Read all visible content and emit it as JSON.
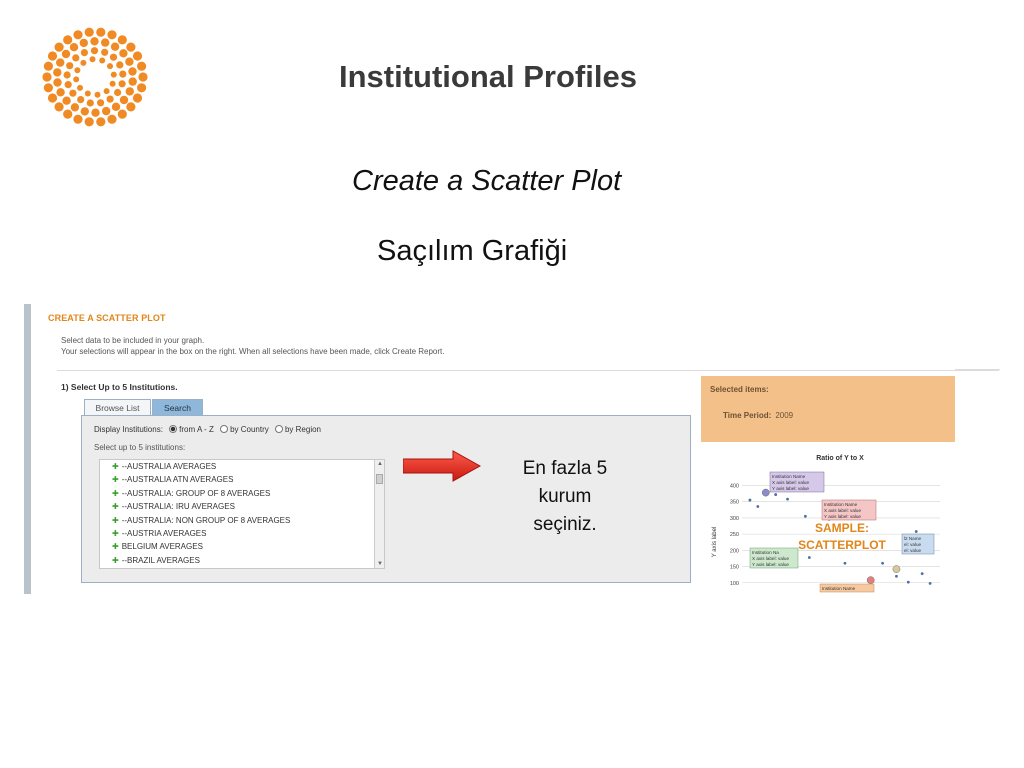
{
  "slide": {
    "title": "Institutional Profiles",
    "subtitle_en": "Create a Scatter Plot",
    "subtitle_tr": "Saçılım Grafiği",
    "callout_lines": [
      "En fazla 5",
      "kurum",
      "seçiniz."
    ]
  },
  "colors": {
    "accent": "#e0861a",
    "logo": "#f08a24",
    "arrow": "#e0261d",
    "selected_panel": "#f3c08a"
  },
  "screenshot": {
    "heading": "CREATE A SCATTER PLOT",
    "intro_line1": "Select data to be included in your graph.",
    "intro_line2": "Your selections will appear in the box on the right. When all selections have been made, click Create Report.",
    "step_label": "1) Select Up to 5 Institutions.",
    "tabs": [
      {
        "label": "Browse List",
        "active": false
      },
      {
        "label": "Search",
        "active": true
      }
    ],
    "display_label": "Display Institutions:",
    "display_options": [
      {
        "label": "from A - Z",
        "selected": true
      },
      {
        "label": "by Country",
        "selected": false
      },
      {
        "label": "by Region",
        "selected": false
      }
    ],
    "select_hint": "Select up to 5 institutions:",
    "institutions": [
      "--AUSTRALIA AVERAGES",
      "--AUSTRALIA ATN AVERAGES",
      "--AUSTRALIA: GROUP OF 8 AVERAGES",
      "--AUSTRALIA: IRU AVERAGES",
      "--AUSTRALIA: NON GROUP OF 8 AVERAGES",
      "--AUSTRIA AVERAGES",
      "BELGIUM AVERAGES",
      "--BRAZIL AVERAGES"
    ],
    "selected_items_title": "Selected items:",
    "time_period_label": "Time Period:",
    "time_period_value": "2009"
  },
  "chart_data": {
    "type": "scatter",
    "title": "Ratio of Y to X",
    "ylabel": "Y axis label",
    "overlay_line1": "SAMPLE:",
    "overlay_line2": "SCATTERPLOT",
    "yticks": [
      400,
      350,
      300,
      250,
      200,
      150,
      100
    ],
    "ylim": [
      90,
      420
    ],
    "xlim": [
      0,
      100
    ],
    "points": [
      {
        "x": 4,
        "y": 355
      },
      {
        "x": 8,
        "y": 335
      },
      {
        "x": 17,
        "y": 372
      },
      {
        "x": 23,
        "y": 358
      },
      {
        "x": 32,
        "y": 305
      },
      {
        "x": 44,
        "y": 296
      },
      {
        "x": 58,
        "y": 310
      },
      {
        "x": 66,
        "y": 340
      },
      {
        "x": 88,
        "y": 258
      },
      {
        "x": 92,
        "y": 232
      },
      {
        "x": 12,
        "y": 190
      },
      {
        "x": 34,
        "y": 178
      },
      {
        "x": 52,
        "y": 160
      },
      {
        "x": 71,
        "y": 160
      },
      {
        "x": 78,
        "y": 120
      },
      {
        "x": 84,
        "y": 102
      },
      {
        "x": 91,
        "y": 128
      },
      {
        "x": 95,
        "y": 98
      }
    ],
    "highlighted": [
      {
        "x": 12,
        "y": 378,
        "color": "#8c8ccc"
      },
      {
        "x": 63,
        "y": 315,
        "color": "#c67f7f"
      },
      {
        "x": 65,
        "y": 108,
        "color": "#e08080"
      },
      {
        "x": 78,
        "y": 142,
        "color": "#d9c7a0"
      }
    ],
    "tooltip_lines": [
      "Institution Name",
      "X axis label: value",
      "Y axis label: value"
    ],
    "tooltip_partial_lines": [
      "Institution Na",
      "X axis label: value",
      "Y axis label: value"
    ],
    "tooltip_right_lines": [
      "l2 Name",
      "el: value",
      "el: value"
    ],
    "tooltip_bottom_line": "Institution Name"
  }
}
